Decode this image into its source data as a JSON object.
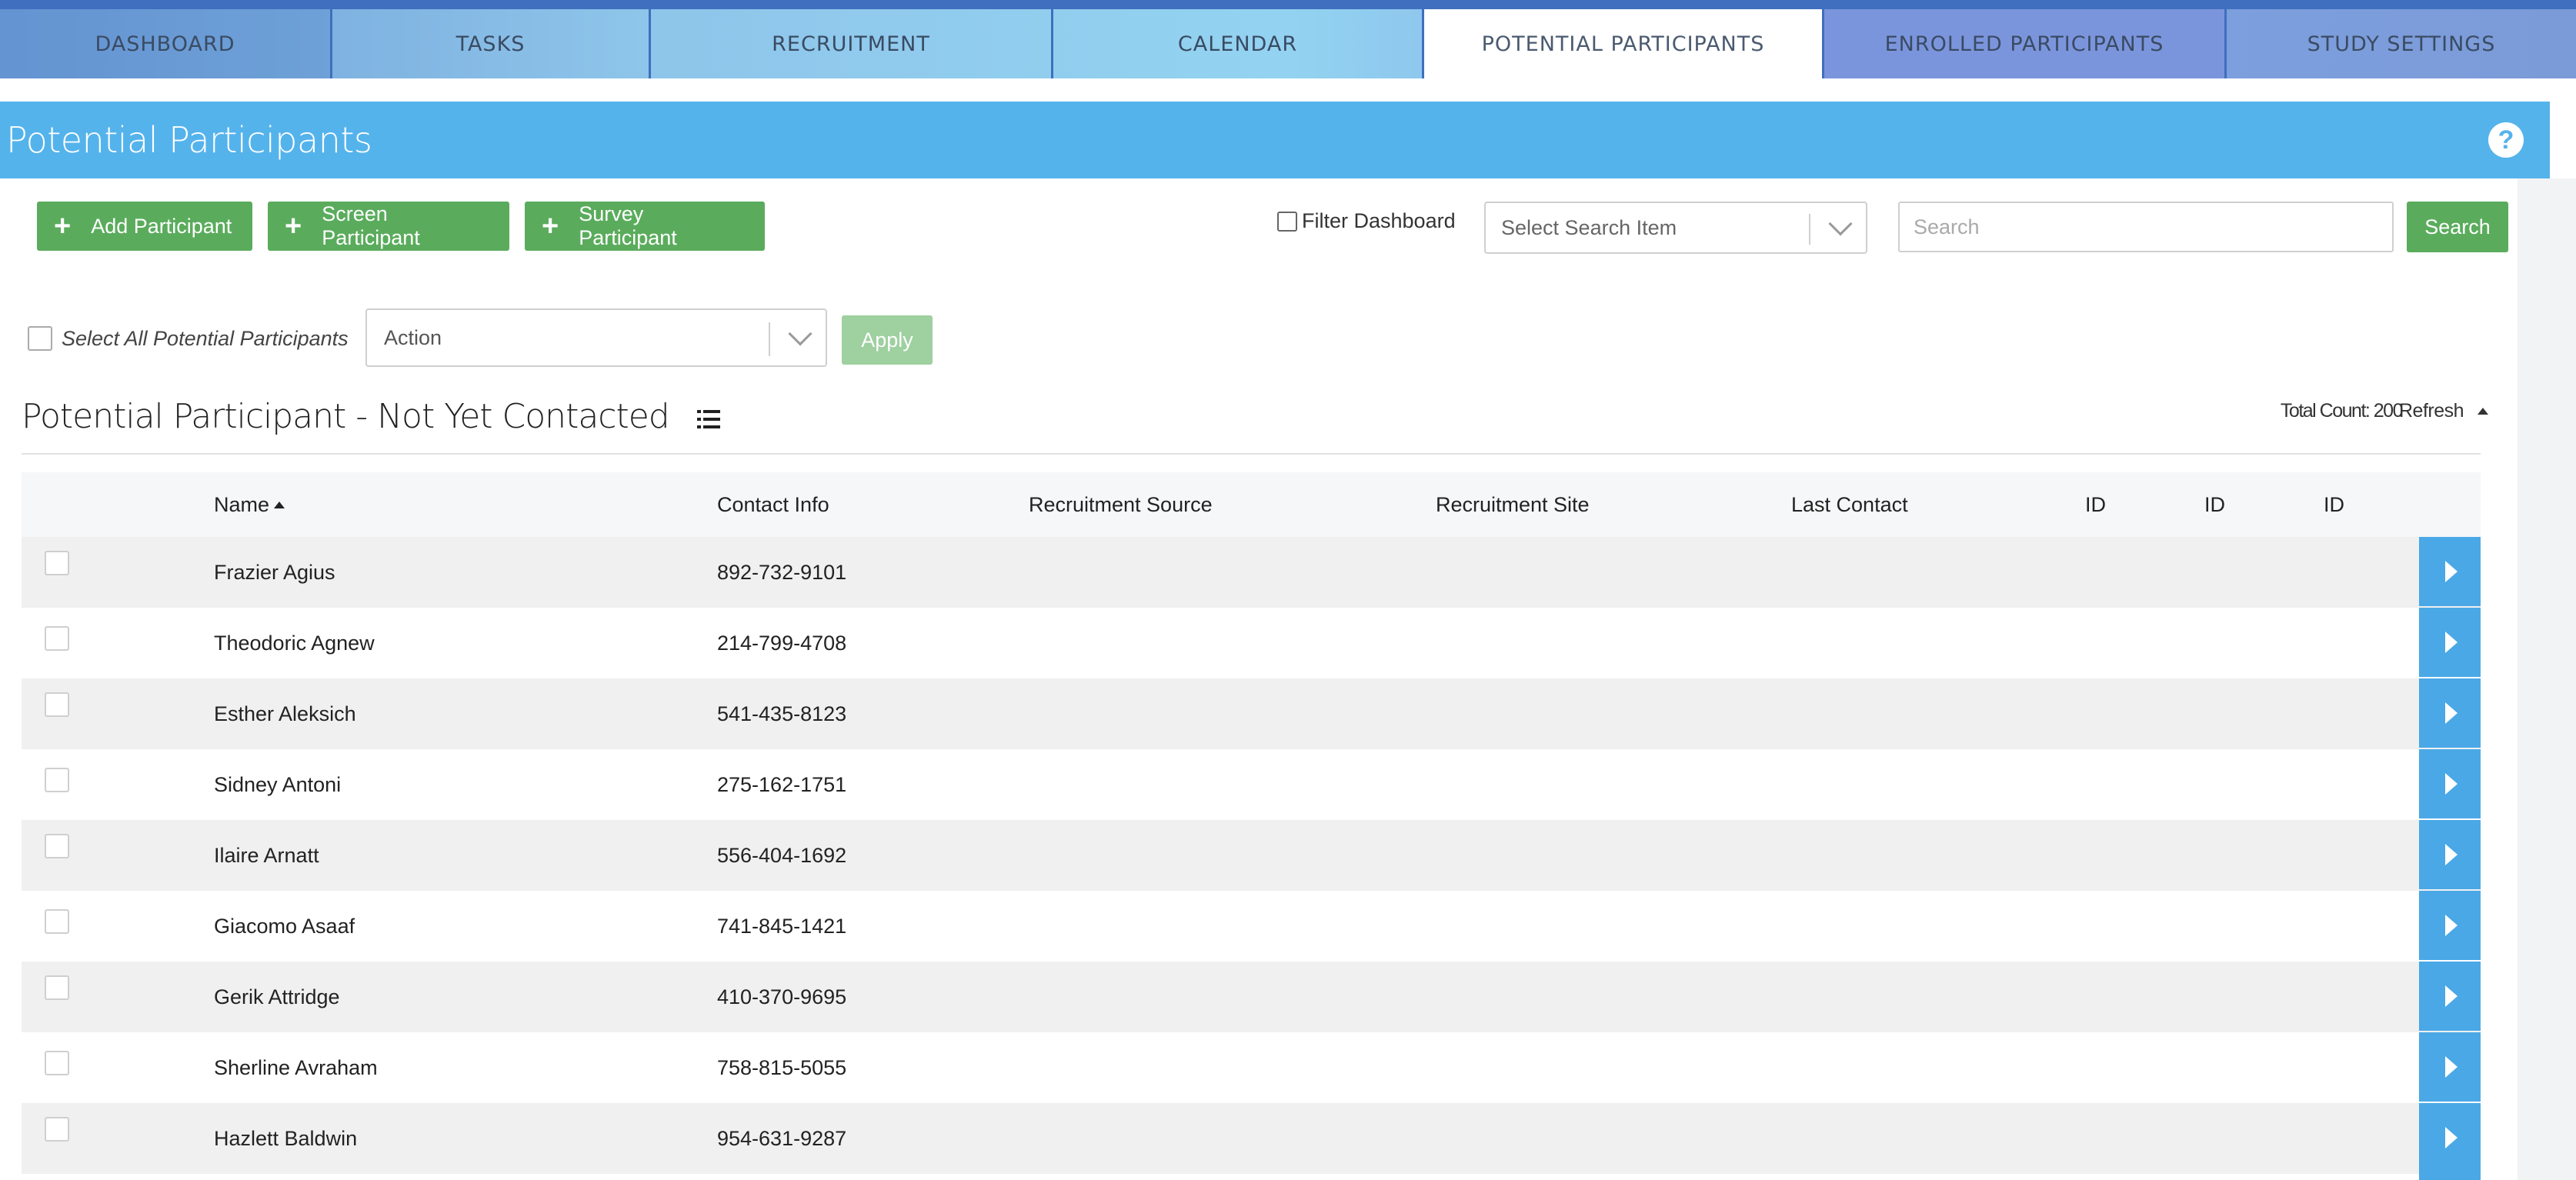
{
  "tabs": [
    {
      "label": "DASHBOARD"
    },
    {
      "label": "TASKS"
    },
    {
      "label": "RECRUITMENT"
    },
    {
      "label": "CALENDAR"
    },
    {
      "label": "POTENTIAL PARTICIPANTS",
      "active": true
    },
    {
      "label": "ENROLLED PARTICIPANTS"
    },
    {
      "label": "STUDY SETTINGS"
    }
  ],
  "header": {
    "title": "Potential Participants",
    "help_glyph": "?"
  },
  "toolbar": {
    "add_label": "Add Participant",
    "screen_label": "Screen Participant",
    "survey_label": "Survey Participant",
    "filter_label": "Filter Dashboard",
    "search_item_value": "Select Search Item",
    "search_placeholder": "Search",
    "search_button": "Search"
  },
  "actions": {
    "select_all_label": "Select All Potential Participants",
    "action_value": "Action",
    "apply_label": "Apply"
  },
  "section": {
    "title": "Potential Participant - Not Yet Contacted",
    "total_count": "Total Count: 200",
    "refresh_label": "Refresh"
  },
  "table": {
    "columns": [
      "Name",
      "Contact Info",
      "Recruitment Source",
      "Recruitment Site",
      "Last Contact",
      "ID",
      "ID",
      "ID"
    ],
    "rows": [
      {
        "name": "Frazier Agius",
        "contact": "892-732-9101"
      },
      {
        "name": "Theodoric Agnew",
        "contact": "214-799-4708"
      },
      {
        "name": "Esther Aleksich",
        "contact": "541-435-8123"
      },
      {
        "name": "Sidney Antoni",
        "contact": "275-162-1751"
      },
      {
        "name": "Ilaire Arnatt",
        "contact": "556-404-1692"
      },
      {
        "name": "Giacomo Asaaf",
        "contact": "741-845-1421"
      },
      {
        "name": "Gerik Attridge",
        "contact": "410-370-9695"
      },
      {
        "name": "Sherline Avraham",
        "contact": "758-815-5055"
      },
      {
        "name": "Hazlett Baldwin",
        "contact": "954-631-9287"
      }
    ]
  },
  "colors": {
    "header_blue": "#55b3ec",
    "button_green": "#5aac5c",
    "row_button_blue": "#4aa8e6"
  }
}
